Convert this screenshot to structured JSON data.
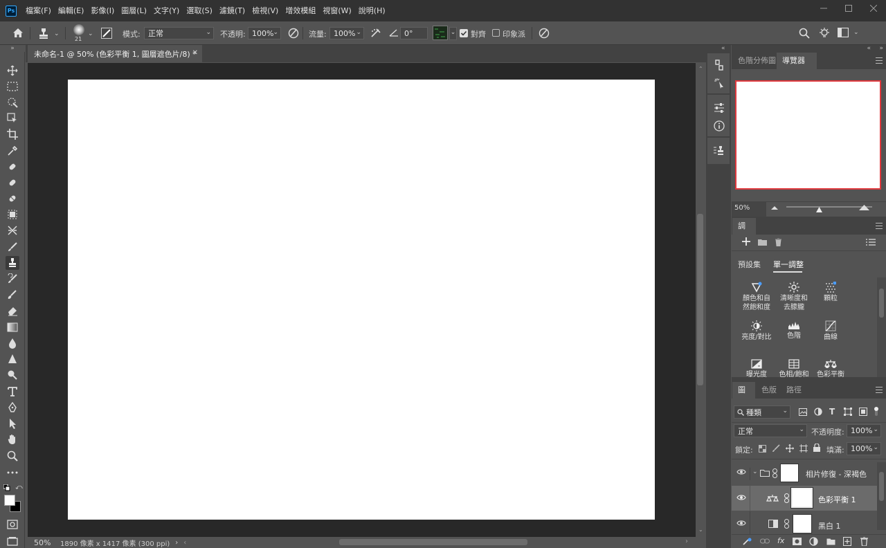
{
  "menubar": {
    "logo": "Ps",
    "items": [
      "檔案(F)",
      "編輯(E)",
      "影像(I)",
      "圖層(L)",
      "文字(Y)",
      "選取(S)",
      "濾鏡(T)",
      "檢視(V)",
      "增效模組",
      "視窗(W)",
      "說明(H)"
    ]
  },
  "options": {
    "brush_size": "21",
    "mode_label": "模式:",
    "mode_value": "正常",
    "opacity_label": "不透明:",
    "opacity_value": "100%",
    "flow_label": "流量:",
    "flow_value": "100%",
    "angle_value": "0°",
    "aligned_label": "對齊",
    "aligned_checked": true,
    "impressionist_label": "印象派",
    "impressionist_checked": false
  },
  "document": {
    "tab_title": "未命名-1 @ 50% (色彩平衡 1, 圖層遮色片/8) *",
    "zoom": "50%",
    "doc_info": "1890 像素 x 1417 像素 (300 ppi)"
  },
  "navigator": {
    "tabs": [
      "色階分佈圖",
      "導覽器"
    ],
    "active_tab": "導覽器",
    "zoom": "50%",
    "slider_fraction": 0.38
  },
  "adjustments": {
    "title": "調整",
    "subtabs": [
      "預設集",
      "單一調整"
    ],
    "active_subtab": "單一調整",
    "items": [
      {
        "label1": "顏色和自",
        "label2": "然飽和度",
        "icon": "vibrance-icon"
      },
      {
        "label1": "清晰度和",
        "label2": "去朦朧",
        "icon": "clarity-icon"
      },
      {
        "label1": "顆粒",
        "label2": "",
        "icon": "grain-icon"
      },
      {
        "label1": "亮度/對比",
        "label2": "",
        "icon": "brightness-icon"
      },
      {
        "label1": "色階",
        "label2": "",
        "icon": "levels-icon"
      },
      {
        "label1": "曲線",
        "label2": "",
        "icon": "curves-icon"
      },
      {
        "label1": "曝光度",
        "label2": "",
        "icon": "exposure-icon"
      },
      {
        "label1": "色相/飽和",
        "label2": "度",
        "icon": "hue-saturation-icon"
      },
      {
        "label1": "色彩平衡",
        "label2": "",
        "icon": "color-balance-icon"
      }
    ]
  },
  "layers": {
    "tabs": [
      "圖層",
      "色版",
      "路徑"
    ],
    "active_tab": "圖層",
    "filter_value": "種類",
    "blend_mode": "正常",
    "opacity_label": "不透明度:",
    "opacity_value": "100%",
    "lock_label": "鎖定:",
    "fill_label": "填滿:",
    "fill_value": "100%",
    "items": [
      {
        "name": "相片修復 - 深褐色",
        "type": "group"
      },
      {
        "name": "色彩平衡 1",
        "type": "color-balance",
        "selected": true
      },
      {
        "name": "黑白 1",
        "type": "black-white"
      }
    ]
  },
  "colors": {
    "accent_red": "#e0393e",
    "check_blue": "#4b9dff"
  }
}
